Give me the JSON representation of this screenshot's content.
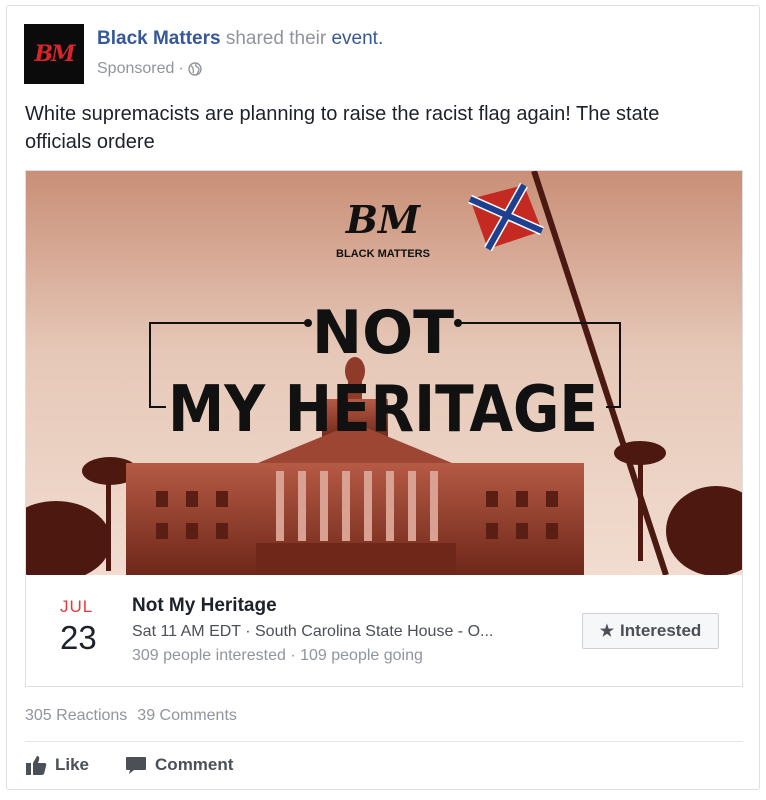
{
  "post": {
    "avatar_text": "BM",
    "page_name": "Black Matters",
    "action_text": "shared their",
    "object_text": "event.",
    "sponsored": "Sponsored",
    "separator": "·",
    "body": "White supremacists are planning to raise the racist flag again! The state officials ordere"
  },
  "image": {
    "logo": "BM",
    "logo_sub": "BLACK MATTERS",
    "headline_line1": "NOT",
    "headline_line2": "MY HERITAGE"
  },
  "event": {
    "month": "JUL",
    "day": "23",
    "title": "Not My Heritage",
    "time_location": "Sat 11 AM EDT · South Carolina State House - O...",
    "stats": "309 people interested · 109 people going",
    "interested_label": "Interested"
  },
  "engagement": {
    "reactions": "305 Reactions",
    "comments": "39 Comments"
  },
  "actions": {
    "like": "Like",
    "comment": "Comment"
  },
  "colors": {
    "link": "#365899",
    "muted": "#90949c",
    "month": "#e4393c",
    "image_tint": "#b5543f"
  }
}
